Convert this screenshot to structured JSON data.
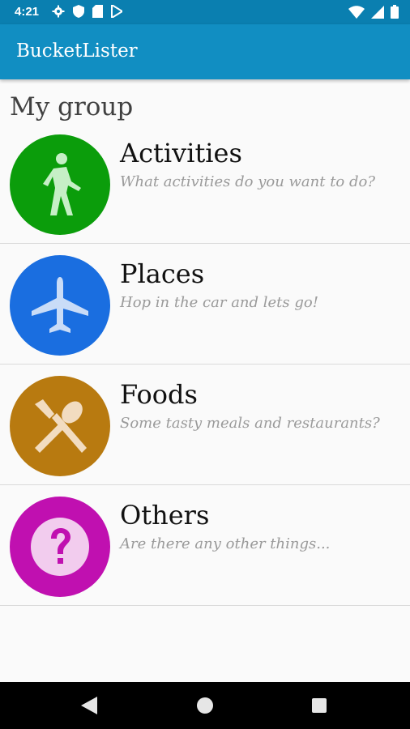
{
  "status_bar": {
    "time": "4:21",
    "left_icons": [
      "gear-icon",
      "shield-icon",
      "sd-card-icon",
      "play-store-icon"
    ],
    "right_icons": [
      "wifi-icon",
      "signal-icon",
      "battery-icon"
    ]
  },
  "app_bar": {
    "title": "BucketLister",
    "color": "#118ec2"
  },
  "group": {
    "title": "My group",
    "categories": [
      {
        "title": "Activities",
        "subtitle": "What activities do you want to do?",
        "icon": "walking-person-icon",
        "color": "#0b9d0b"
      },
      {
        "title": "Places",
        "subtitle": "Hop in the car and lets go!",
        "icon": "airplane-icon",
        "color": "#1a6ee0"
      },
      {
        "title": "Foods",
        "subtitle": "Some tasty meals and restaurants?",
        "icon": "fork-spoon-icon",
        "color": "#b87a10"
      },
      {
        "title": "Others",
        "subtitle": "Are there any other things...",
        "icon": "question-mark-icon",
        "color": "#c010b0"
      }
    ]
  },
  "nav_bar": {
    "buttons": [
      "back-icon",
      "home-icon",
      "recents-icon"
    ]
  }
}
